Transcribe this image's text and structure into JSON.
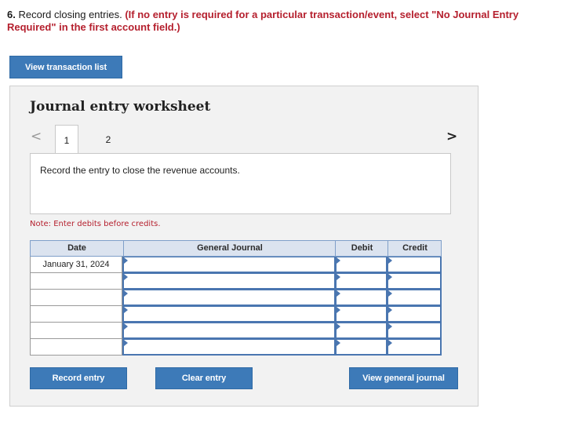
{
  "question": {
    "number": "6.",
    "text": "Record closing entries.",
    "instruction": "(If no entry is required for a particular transaction/event, select \"No Journal Entry Required\" in the first account field.)"
  },
  "buttons": {
    "view_transaction_list": "View transaction list",
    "record_entry": "Record entry",
    "clear_entry": "Clear entry",
    "view_general_journal": "View general journal"
  },
  "worksheet": {
    "title": "Journal entry worksheet",
    "nav_prev": "<",
    "nav_next": ">",
    "tabs": [
      {
        "label": "1",
        "active": true
      },
      {
        "label": "2",
        "active": false
      }
    ],
    "prompt": "Record the entry to close the revenue accounts.",
    "note": "Note: Enter debits before credits."
  },
  "journal": {
    "headers": {
      "date": "Date",
      "general_journal": "General Journal",
      "debit": "Debit",
      "credit": "Credit"
    },
    "rows": [
      {
        "date": "January 31, 2024",
        "account": "",
        "debit": "",
        "credit": ""
      },
      {
        "date": "",
        "account": "",
        "debit": "",
        "credit": ""
      },
      {
        "date": "",
        "account": "",
        "debit": "",
        "credit": ""
      },
      {
        "date": "",
        "account": "",
        "debit": "",
        "credit": ""
      },
      {
        "date": "",
        "account": "",
        "debit": "",
        "credit": ""
      },
      {
        "date": "",
        "account": "",
        "debit": "",
        "credit": ""
      }
    ]
  },
  "colors": {
    "button": "#3d7ab8",
    "instruction": "#b5202e",
    "panel": "#f2f2f2",
    "input_border": "#4a76b0",
    "header_bg": "#dbe3ef"
  }
}
